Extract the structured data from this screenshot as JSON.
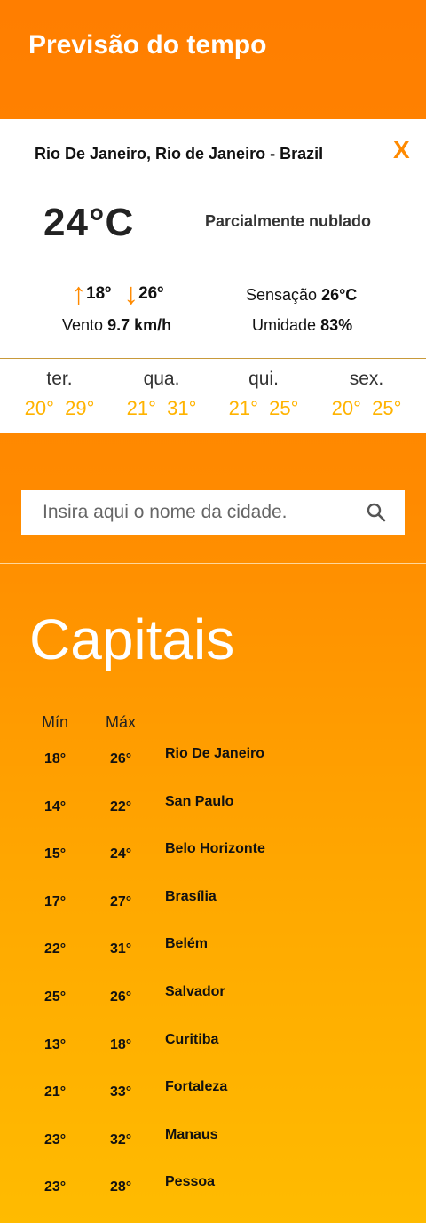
{
  "header": {
    "title": "Previsão do tempo"
  },
  "current": {
    "location": "Rio De Janeiro, Rio de Janeiro - Brazil",
    "close_label": "X",
    "temperature": "24°C",
    "condition": "Parcialmente nublado",
    "min": "18º",
    "max": "26º",
    "feels_label": "Sensação",
    "feels_value": "26°C",
    "wind_label": "Vento",
    "wind_value": "9.7 km/h",
    "humidity_label": "Umidade",
    "humidity_value": "83%"
  },
  "forecast": [
    {
      "day": "ter.",
      "temps": "20°  29°"
    },
    {
      "day": "qua.",
      "temps": "21°  31°"
    },
    {
      "day": "qui.",
      "temps": "21°  25°"
    },
    {
      "day": "sex.",
      "temps": "20°  25°"
    }
  ],
  "search": {
    "placeholder": "Insira aqui o nome da cidade."
  },
  "capitals": {
    "title": "Capitais",
    "min_header": "Mín",
    "max_header": "Máx",
    "rows": [
      {
        "min": "18°",
        "max": "26°",
        "city": "Rio De Janeiro"
      },
      {
        "min": "14°",
        "max": "22°",
        "city": "San Paulo"
      },
      {
        "min": "15°",
        "max": "24°",
        "city": "Belo Horizonte"
      },
      {
        "min": "17°",
        "max": "27°",
        "city": "Brasília"
      },
      {
        "min": "22°",
        "max": "31°",
        "city": "Belém"
      },
      {
        "min": "25°",
        "max": "26°",
        "city": "Salvador"
      },
      {
        "min": "13°",
        "max": "18°",
        "city": "Curitiba"
      },
      {
        "min": "21°",
        "max": "33°",
        "city": "Fortaleza"
      },
      {
        "min": "23°",
        "max": "32°",
        "city": "Manaus"
      },
      {
        "min": "23°",
        "max": "28°",
        "city": "Pessoa"
      }
    ]
  },
  "colors": {
    "accent": "#ff8a00",
    "forecast_temp": "#ffb300"
  }
}
